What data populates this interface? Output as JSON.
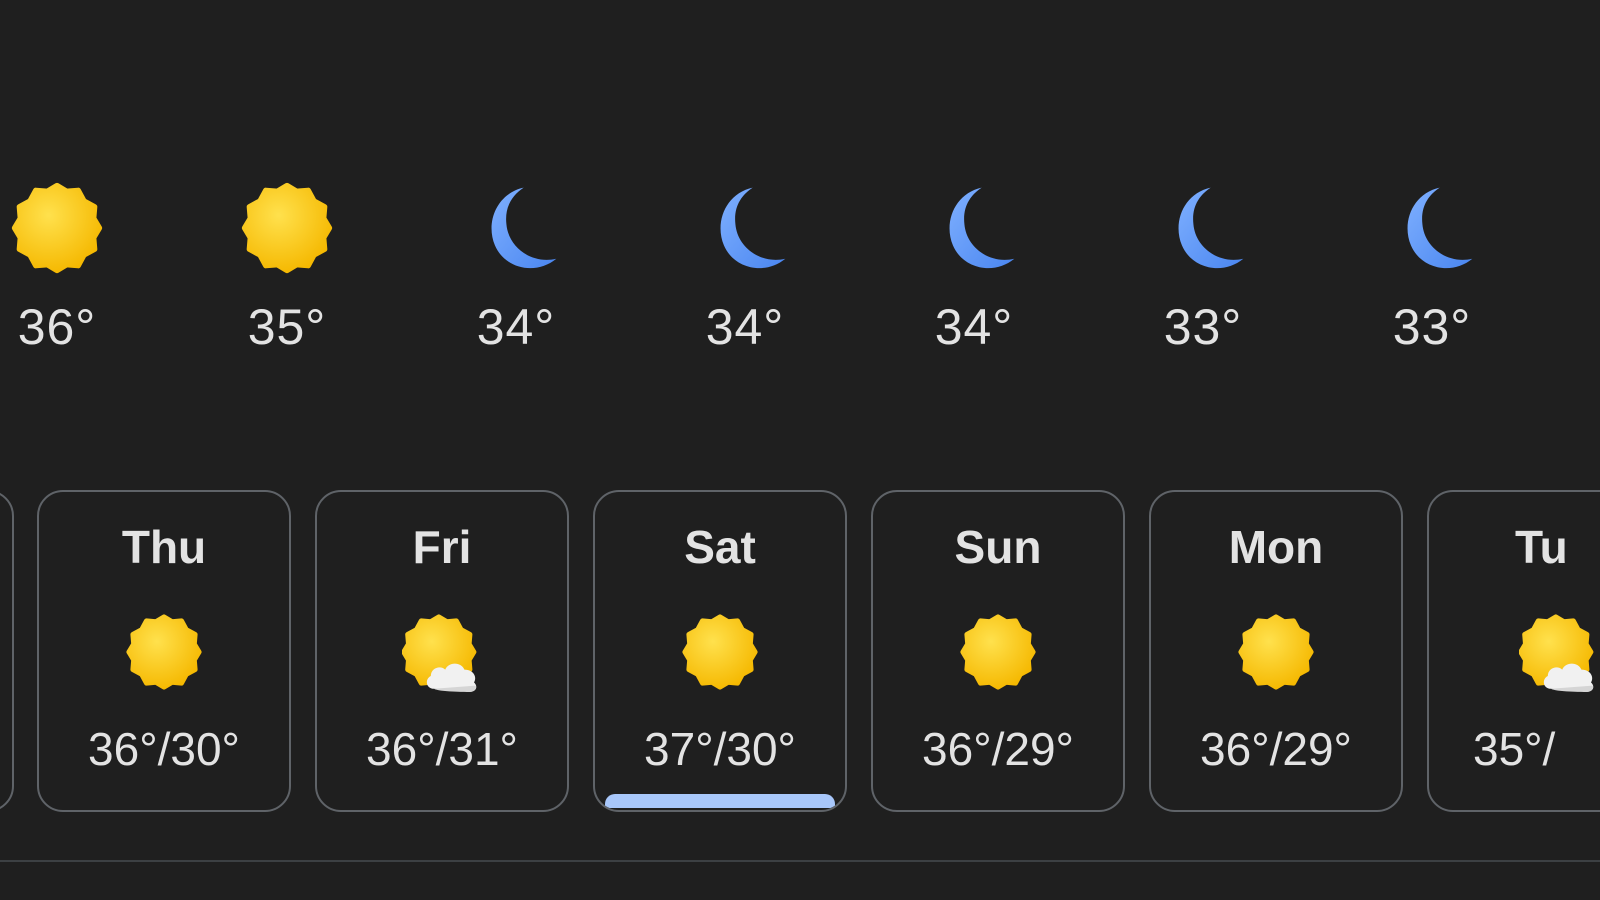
{
  "hourly": [
    {
      "temp": "36°",
      "icon": "sun-icon"
    },
    {
      "temp": "35°",
      "icon": "sun-icon"
    },
    {
      "temp": "34°",
      "icon": "moon-icon"
    },
    {
      "temp": "34°",
      "icon": "moon-icon"
    },
    {
      "temp": "34°",
      "icon": "moon-icon"
    },
    {
      "temp": "33°",
      "icon": "moon-icon"
    },
    {
      "temp": "33°",
      "icon": "moon-icon"
    }
  ],
  "daily": [
    {
      "day": "Thu",
      "range": "36°/30°",
      "icon": "sun-icon",
      "selected": false
    },
    {
      "day": "Fri",
      "range": "36°/31°",
      "icon": "sun-cloud-icon",
      "selected": false
    },
    {
      "day": "Sat",
      "range": "37°/30°",
      "icon": "sun-icon",
      "selected": true
    },
    {
      "day": "Sun",
      "range": "36°/29°",
      "icon": "sun-icon",
      "selected": false
    },
    {
      "day": "Mon",
      "range": "36°/29°",
      "icon": "sun-icon",
      "selected": false
    },
    {
      "day": "Tu",
      "range": "35°/",
      "icon": "sun-cloud-icon",
      "selected": false
    }
  ],
  "colors": {
    "background": "#1f1f1f",
    "text": "#e3e3e3",
    "card_border": "#5f6368",
    "selected_bar": "#a8c7fa",
    "sun": "#fdd22f",
    "moon": "#6aa1ff"
  }
}
